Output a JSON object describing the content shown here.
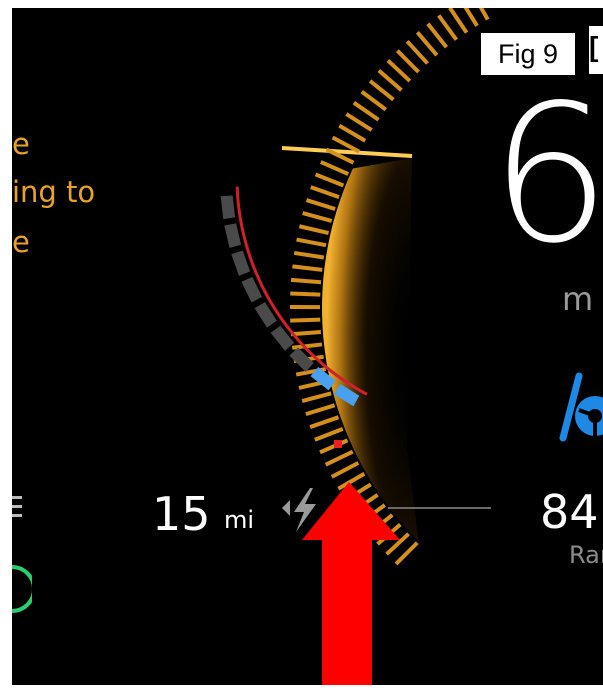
{
  "figure_label": "Fig 9",
  "bracket_glyph": "[",
  "message": {
    "line1": "e",
    "line2": "ing to",
    "line3": "e"
  },
  "speed": {
    "value": "6",
    "unit": "m"
  },
  "electric_range": {
    "value": "15",
    "unit": "mi"
  },
  "total_range": {
    "value": "84",
    "label": "Ran"
  },
  "colors": {
    "background": "#000000",
    "message": "#e8a22a",
    "gauge_amber": "#d4901a",
    "gauge_red": "#d0202a",
    "gauge_blue": "#4aa0f0",
    "gauge_gray": "#4a4a4a",
    "pointer_arrow": "#ff0000",
    "eco_green": "#2ecc71",
    "mode_blue": "#1e88e5"
  },
  "icons": [
    "ev-lightning-icon",
    "drive-mode-icon",
    "eco-ring-icon",
    "pointer-arrow-icon"
  ]
}
